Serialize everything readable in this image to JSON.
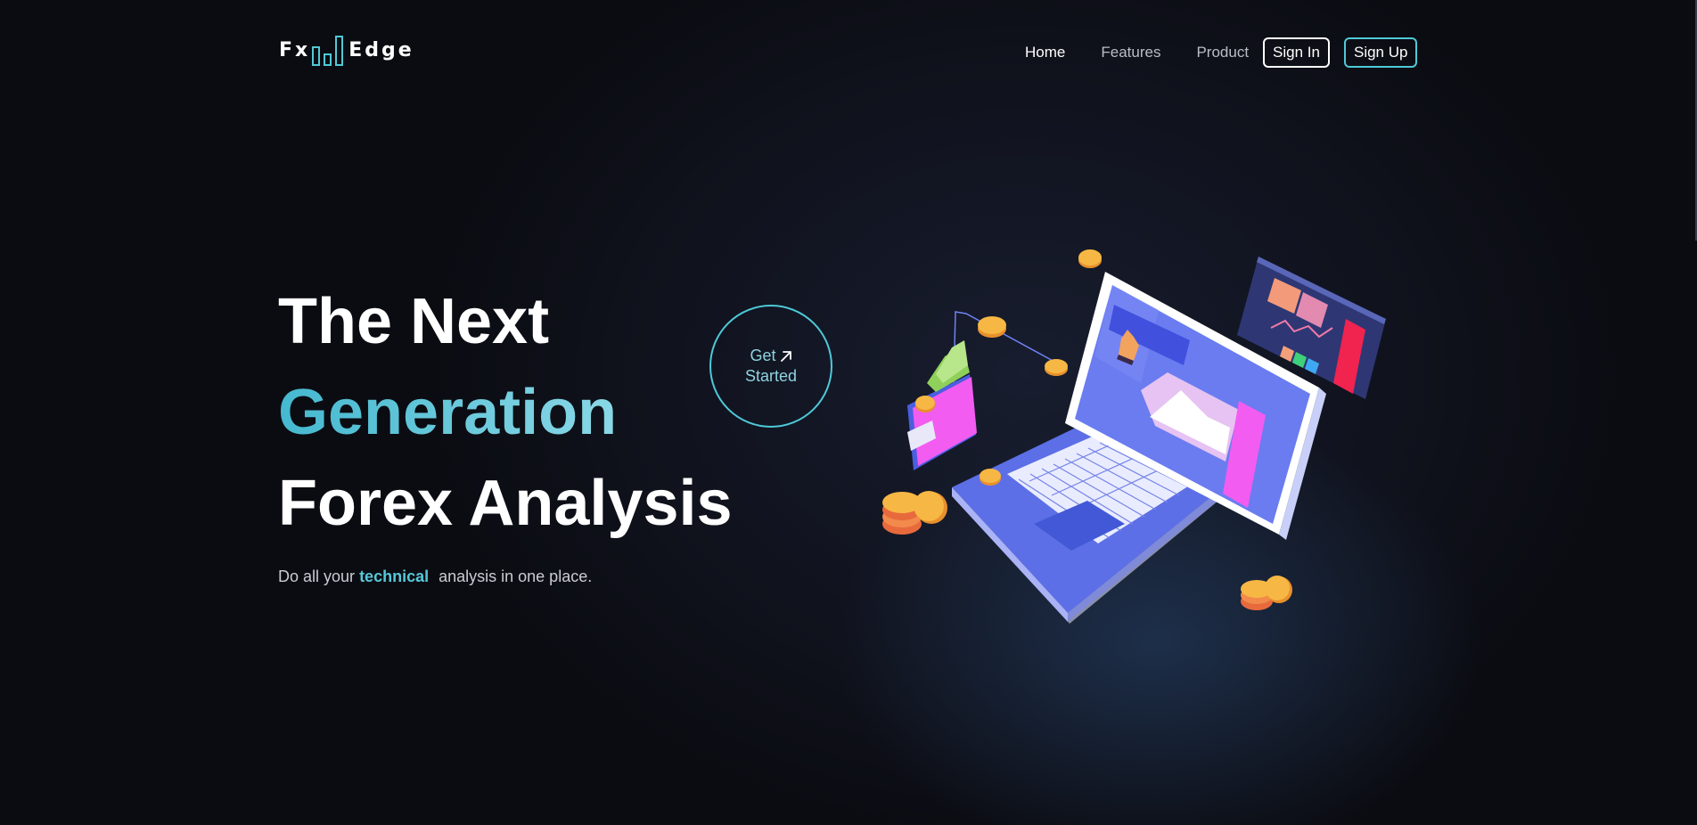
{
  "logo": {
    "left_text": "Fx",
    "right_text": "Edge",
    "icon": "bar-chart-icon",
    "accent_color": "#4fc9d8"
  },
  "nav": {
    "links": [
      "Home",
      "Features",
      "Product"
    ],
    "sign_in": "Sign In",
    "sign_up": "Sign Up"
  },
  "hero": {
    "line1": "The Next",
    "line2": "Generation",
    "line3": "Forex Analysis",
    "subtitle_before": "Do all your",
    "subtitle_accent": "technical",
    "subtitle_after": "analysis in one place."
  },
  "cta": {
    "line1": "Get",
    "line2": "Started",
    "icon": "arrow-up-right-icon"
  },
  "illustration": {
    "name": "isometric-laptop-finance-illustration"
  },
  "colors": {
    "background": "#0b0c12",
    "accent": "#4fc9d8",
    "laptop": "#5b6ee8",
    "pink": "#f25cf0",
    "coin": "#f7b744"
  }
}
